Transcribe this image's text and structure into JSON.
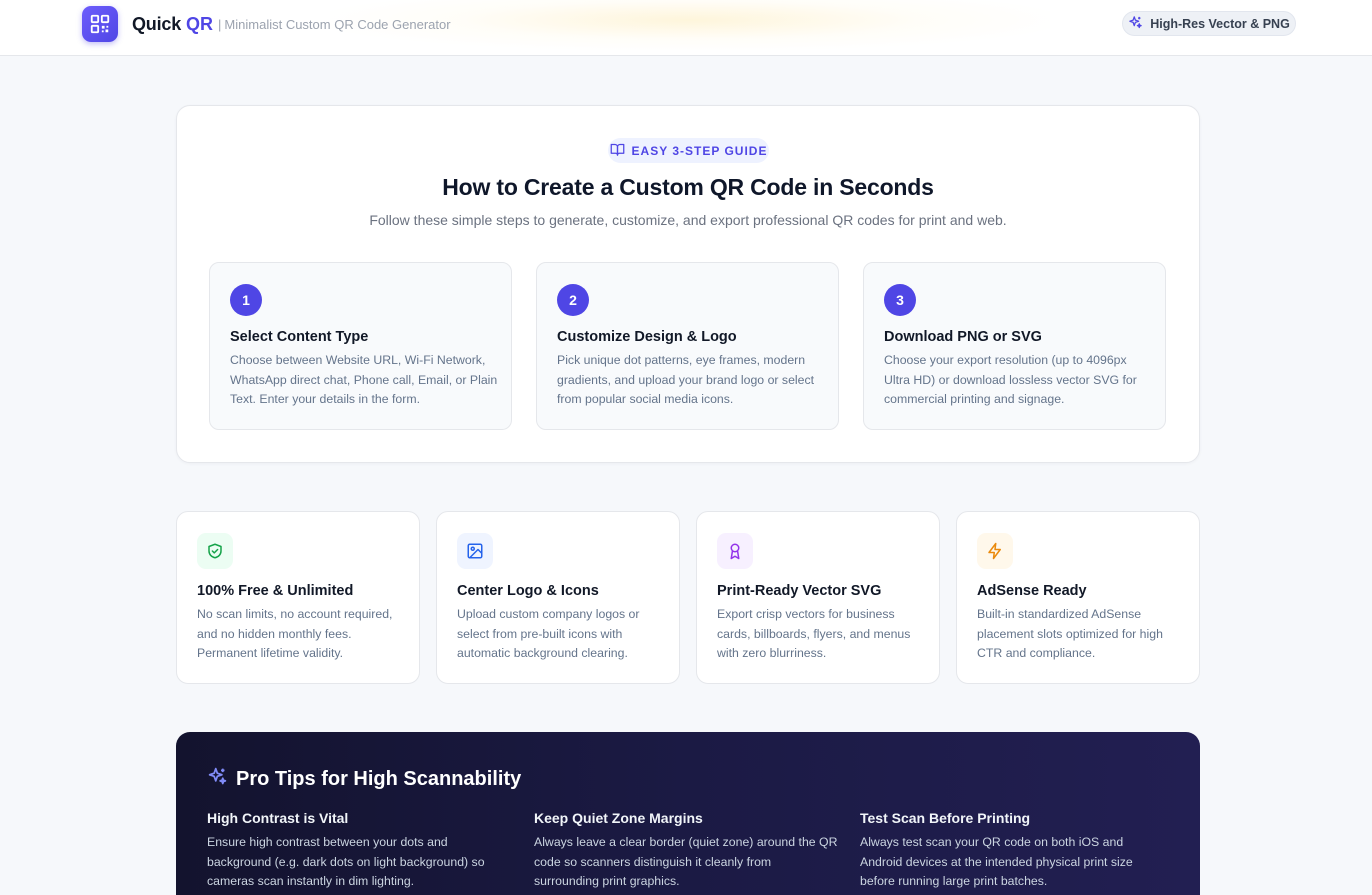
{
  "header": {
    "brand_name": "Quick",
    "brand_accent": "QR",
    "separator": "|",
    "tagline": "Minimalist Custom QR Code Generator",
    "badge_label": "High-Res Vector & PNG",
    "badge_icon": "sparkles-icon",
    "logo_icon": "qr-code-icon",
    "accent_color": "#4f46e5"
  },
  "guide": {
    "badge": "EASY 3-STEP GUIDE",
    "badge_icon": "book-open-icon",
    "title": "How to Create a Custom QR Code in Seconds",
    "subtitle": "Follow these simple steps to generate, customize, and export professional QR codes for print and web.",
    "steps": [
      {
        "number": "1",
        "title": "Select Content Type",
        "description": "Choose between Website URL, Wi-Fi Network, WhatsApp direct chat, Phone call, Email, or Plain Text. Enter your details in the form."
      },
      {
        "number": "2",
        "title": "Customize Design & Logo",
        "description": "Pick unique dot patterns, eye frames, modern gradients, and upload your brand logo or select from popular social media icons."
      },
      {
        "number": "3",
        "title": "Download PNG or SVG",
        "description": "Choose your export resolution (up to 4096px Ultra HD) or download lossless vector SVG for commercial printing and signage."
      }
    ]
  },
  "features": [
    {
      "icon": "shield-check-icon",
      "icon_color": "#16a34a",
      "icon_bg": "#ecfdf3",
      "title": "100% Free & Unlimited",
      "description": "No scan limits, no account required, and no hidden monthly fees. Permanent lifetime validity."
    },
    {
      "icon": "image-icon",
      "icon_color": "#2563eb",
      "icon_bg": "#eff4ff",
      "title": "Center Logo & Icons",
      "description": "Upload custom company logos or select from pre-built icons with automatic background clearing."
    },
    {
      "icon": "award-icon",
      "icon_color": "#9333ea",
      "icon_bg": "#f7f0ff",
      "title": "Print-Ready Vector SVG",
      "description": "Export crisp vectors for business cards, billboards, flyers, and menus with zero blurriness."
    },
    {
      "icon": "lightning-icon",
      "icon_color": "#ea8a0c",
      "icon_bg": "#fff8eb",
      "title": "AdSense Ready",
      "description": "Built-in standardized AdSense placement slots optimized for high CTR and compliance."
    }
  ],
  "tips": {
    "title": "Pro Tips for High Scannability",
    "title_icon": "sparkles-icon",
    "items": [
      {
        "title": "High Contrast is Vital",
        "description": "Ensure high contrast between your dots and background (e.g. dark dots on light background) so cameras scan instantly in dim lighting."
      },
      {
        "title": "Keep Quiet Zone Margins",
        "description": "Always leave a clear border (quiet zone) around the QR code so scanners distinguish it cleanly from surrounding print graphics."
      },
      {
        "title": "Test Scan Before Printing",
        "description": "Always test scan your QR code on both iOS and Android devices at the intended physical print size before running large print batches."
      }
    ]
  }
}
